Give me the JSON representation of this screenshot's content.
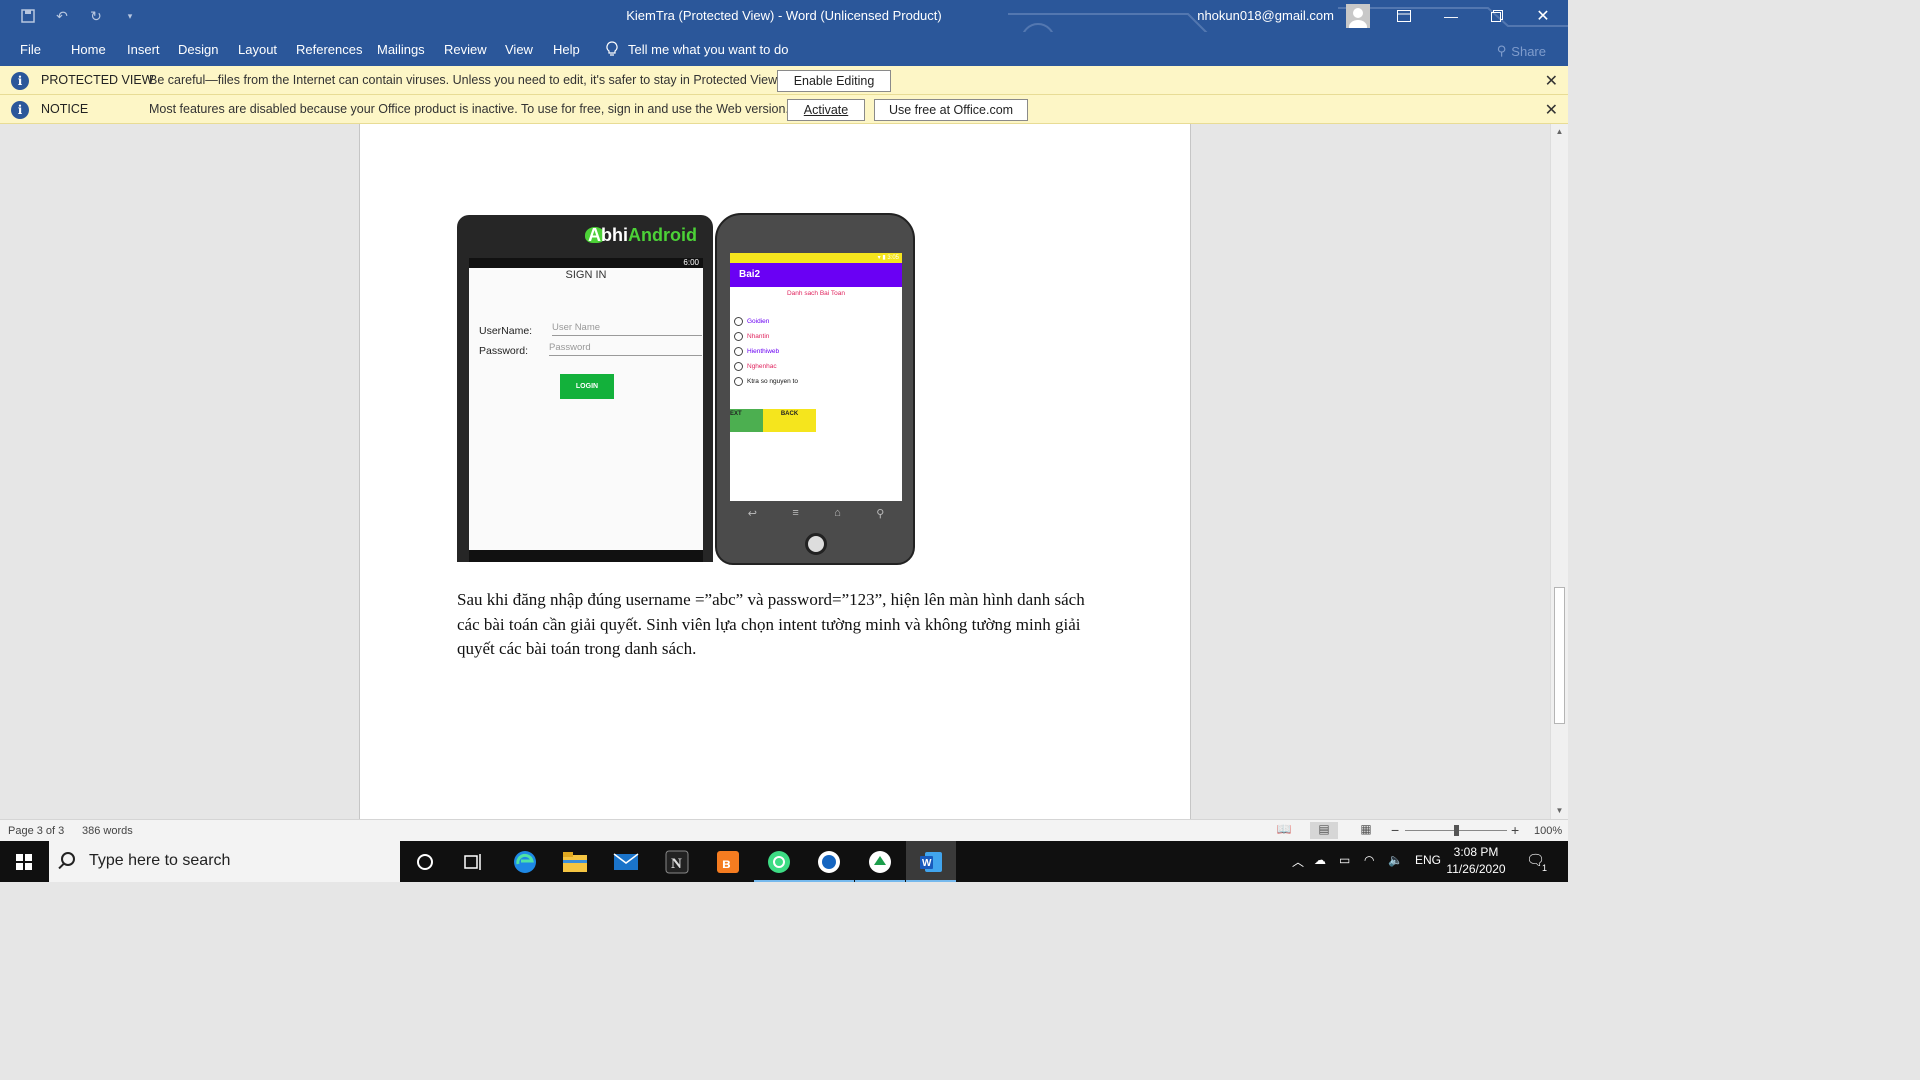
{
  "window": {
    "title": "KiemTra (Protected View)  -  Word (Unlicensed Product)",
    "account": "nhokun018@gmail.com"
  },
  "ribbon": {
    "tabs": [
      "File",
      "Home",
      "Insert",
      "Design",
      "Layout",
      "References",
      "Mailings",
      "Review",
      "View",
      "Help"
    ],
    "tell_me": "Tell me what you want to do",
    "share": "Share"
  },
  "protected_bar": {
    "label": "PROTECTED VIEW",
    "message": "Be careful—files from the Internet can contain viruses. Unless you need to edit, it's safer to stay in Protected View.",
    "button": "Enable Editing"
  },
  "notice_bar": {
    "label": "NOTICE",
    "message": "Most features are disabled because your Office product is inactive. To use for free, sign in and use the Web version.",
    "activate": "Activate",
    "use_free": "Use free at Office.com"
  },
  "document": {
    "paragraph": "Sau khi đăng nhập đúng username =”abc” và password=”123”, hiện lên màn hình danh sách các bài toán cần giải quyết. Sinh viên lựa chọn intent tường minh và không tường minh giải quyết các bài toán trong danh sách.",
    "phone1": {
      "brand_a": "Abhi",
      "brand_b": "Android",
      "time": "6:00",
      "title": "SIGN IN",
      "username_label": "UserName:",
      "username_placeholder": "User Name",
      "password_label": "Password:",
      "password_placeholder": "Password",
      "login": "LOGIN"
    },
    "phone2": {
      "app_title": "Bai2",
      "subtitle": "Danh sach Bai Toan",
      "options": [
        {
          "label": "Goidien",
          "color": "#6a00f4"
        },
        {
          "label": "Nhantin",
          "color": "#e0245e"
        },
        {
          "label": "Hienthiweb",
          "color": "#6a00f4"
        },
        {
          "label": "Nghenhac",
          "color": "#e0245e"
        },
        {
          "label": "Ktra so nguyen to",
          "color": "#111111"
        }
      ],
      "next": "EXT",
      "back": "BACK"
    }
  },
  "status": {
    "page": "Page 3 of 3",
    "words": "386 words",
    "zoom": "100%"
  },
  "taskbar": {
    "search_placeholder": "Type here to search",
    "language": "ENG",
    "time": "3:08 PM",
    "date": "11/26/2020",
    "notification_count": "1"
  }
}
